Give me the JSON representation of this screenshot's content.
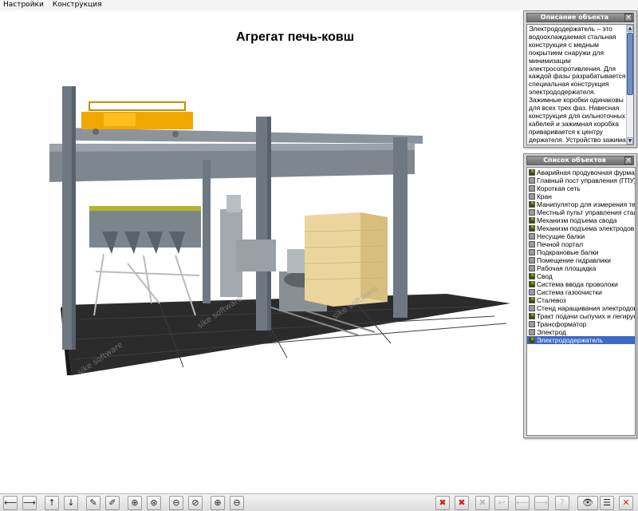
{
  "menu": {
    "items": [
      "Настройки",
      "Конструкция"
    ]
  },
  "scene": {
    "title": "Агрегат печь-ковш",
    "watermark": "sike software"
  },
  "description_panel": {
    "title": "Описание объекта",
    "text": "Электрододержатель – это\nводоохлаждаемая стальная\nконструкция с медным\nпокрытием снаружи для\nминимизации\nэлектросопротивления. Для\nкаждой фазы разрабатывается\nспециальная конструкция\nэлектрододержателя.\nЗажимные коробки одинаковы\nдля всех трех фаз. Навесная\nконструкция для сильноточных\nкабелей и зажимная коробка\nприваривается к центру\nдержателя. Устройство зажима"
  },
  "objects_panel": {
    "title": "Список объектов",
    "items": [
      {
        "label": "Аварийная продувочная фурма",
        "checked": true
      },
      {
        "label": "Главный пост управления (ГПУ)",
        "checked": false
      },
      {
        "label": "Короткая сеть",
        "checked": false
      },
      {
        "label": "Кран",
        "checked": false
      },
      {
        "label": "Манипулятор для измерения тем",
        "checked": true
      },
      {
        "label": "Местный пульт управления стале",
        "checked": false
      },
      {
        "label": "Механизм подъема свода",
        "checked": true
      },
      {
        "label": "Механизм подъема электродов",
        "checked": true
      },
      {
        "label": "Несущие балки",
        "checked": false
      },
      {
        "label": "Печной портал",
        "checked": false
      },
      {
        "label": "Подкрановые балки",
        "checked": false
      },
      {
        "label": "Помещение гидравлики",
        "checked": false
      },
      {
        "label": "Рабочая площадка",
        "checked": false
      },
      {
        "label": "Свод",
        "checked": true
      },
      {
        "label": "Система ввода проволоки",
        "checked": true
      },
      {
        "label": "Система газоочистки",
        "checked": false
      },
      {
        "label": "Сталевоз",
        "checked": true
      },
      {
        "label": "Стенд наращивания электродов",
        "checked": false
      },
      {
        "label": "Тракт подачи сыпучих и легирую",
        "checked": true
      },
      {
        "label": "Трансформатор",
        "checked": false
      },
      {
        "label": "Электрод",
        "checked": false
      },
      {
        "label": "Электрододержатель",
        "checked": true,
        "selected": true
      }
    ]
  },
  "toolbar": {
    "left_buttons": [
      "arrow-left",
      "arrow-right",
      "arrow-up",
      "arrow-down",
      "pencil",
      "pencil-alt",
      "rotate-x",
      "rotate-y",
      "rotate-z",
      "rotate-free",
      "zoom-in",
      "zoom-out"
    ],
    "right_buttons": [
      "hide-selected",
      "hide-all",
      "show-all",
      "undo",
      "step-back",
      "step-forward",
      "help",
      "view-eye",
      "list",
      "close"
    ]
  },
  "colors": {
    "selection": "#3a6ac6",
    "close_button": "#d21e1e",
    "crane_yellow": "#f0a800",
    "floor": "#2b2b2b"
  }
}
